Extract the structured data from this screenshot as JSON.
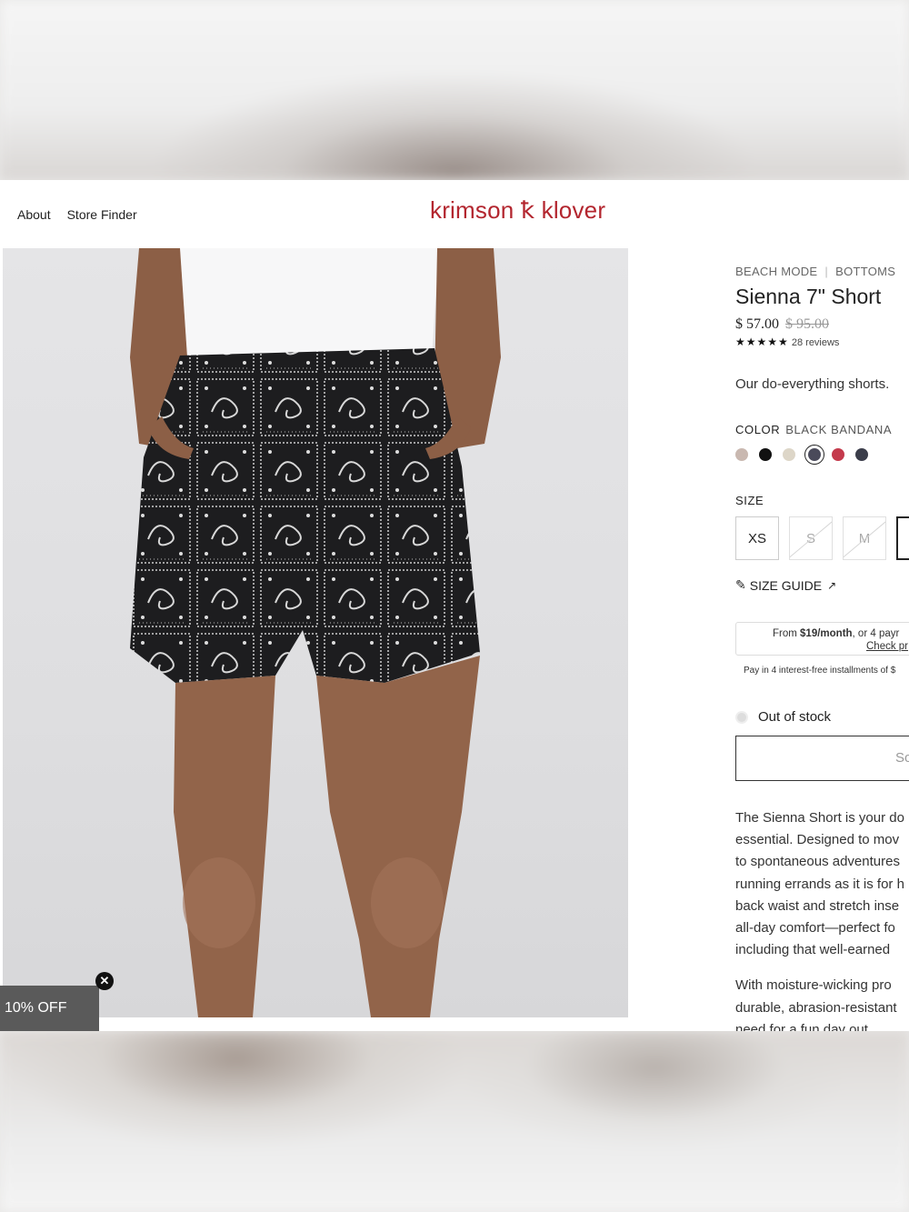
{
  "nav": {
    "items": [
      "About",
      "Store Finder"
    ]
  },
  "brand": {
    "logo_text": "krimson ꝁ klover",
    "color": "#b3262f"
  },
  "product": {
    "breadcrumb": [
      "BEACH MODE",
      "BOTTOMS"
    ],
    "title": "Sienna 7\" Short",
    "price": "$ 57.00",
    "compare_price": "$ 95.00",
    "rating_stars": "★★★★★",
    "reviews": "28 reviews",
    "tagline": "Our do-everything shorts.",
    "color_label": "COLOR",
    "color_value": "BLACK BANDANA",
    "swatches": [
      "#c9b8b0",
      "#111111",
      "#ddd6c8",
      "#4a4a5a",
      "#c43a4c",
      "#3b3d4a"
    ],
    "size_label": "SIZE",
    "sizes": [
      "XS",
      "S",
      "M",
      ""
    ],
    "size_guide": "SIZE GUIDE",
    "pay_line1_prefix": "From ",
    "pay_line1_bold": "$19/month",
    "pay_line1_suffix": ", or 4 payr",
    "pay_line2": "Check pr",
    "installments": "Pay in 4 interest-free installments of $",
    "stock_status": "Out of stock",
    "sold_button": "So",
    "description_p1": [
      "The Sienna Short is your do",
      "essential. Designed to mov",
      "to spontaneous adventures",
      "running errands as it is for h",
      "back waist and stretch inse",
      "all-day comfort—perfect fo",
      "including that well-earned"
    ],
    "description_p2": [
      "With moisture-wicking pro",
      "durable, abrasion-resistant",
      "need for a fun day out"
    ]
  },
  "promo": {
    "label": "10% OFF",
    "close": "✕"
  }
}
